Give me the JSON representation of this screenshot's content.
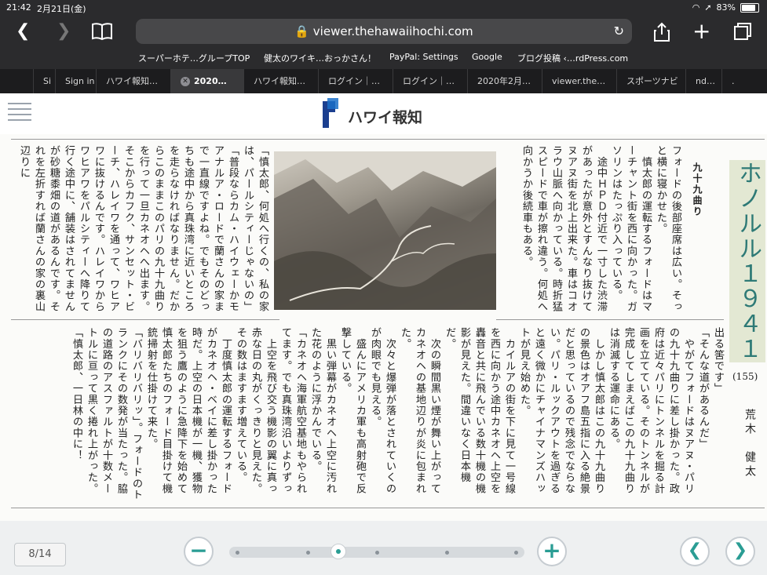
{
  "status": {
    "time": "21:42",
    "date": "2月21日(金)",
    "battery": "83%",
    "battery_level": 0.83
  },
  "toolbar": {
    "url": "viewer.thehawaiihochi.com"
  },
  "favorites": [
    "スーパーホテ…グループTOP",
    "健太のワイキ…おっかさん！",
    "PayPal: Settings",
    "Google",
    "ブログ投稿 ‹…rdPress.com"
  ],
  "tabs": [
    "Si",
    "Sign in",
    "ハワイ報知…",
    "2020…",
    "ハワイ報知…",
    "ログイン｜…",
    "ログイン｜…",
    "2020年2月…",
    "viewer.the…",
    "スポーツナビ",
    "nd…",
    "."
  ],
  "active_tab_index": 3,
  "site": {
    "name": "ハワイ報知"
  },
  "article": {
    "series_title": "ホノルル１９４１",
    "episode": "(155)",
    "author": "荒木　健太",
    "section_heading": "九十九曲り",
    "columns": [
      "フォードの後部座席は広い。そっと横に寝かせた。\n　慎太郎の運転するフォードはマーチャント街を西に向かった。ガソリンはたっぷり入っている。\n　途中ＨＰＤ付近で一寸した渋滞があったが意外とすんなり抜けてヌアヌ街を北上出来た。車はコオラウ山脈へ向かっている。時折猛スピードで車が擦れ違う。何処へ向かうか後続車もある。",
      "「慎太郎、何処へ行くの、私の家は、パールシティーじゃないの」\n「普段ならカム・ハイウェーかモアナルア・ロードで蘭さんの家まで一直線ですよね。でもそのどっちも途中から真珠湾に近いところを走らなければなりません。だからこのままこのパリの九十九曲りを行って一旦カネオヘへ出ます。そこからカフク、サンセット・ビーチ、ハレイワを通って、ワヒアワに抜けるんです。ハレイワからワヒアワをパルシティーへ降りて行く途中に、舗装はされてませんが砂糖黍畑の道があるんです。それを左折すれば蘭さんの家の裏山辺りに",
      "出る筈です」\n「そんな道があるんだ」\n　やがてフォードはヌアヌ・パリの九十九曲りに差し掛かった。政府は近々パリにトンネルを掘る計画を立てている。そのトンネルが完成してしまえばこの九十九曲りは消滅する運命にある。\n　しかし慎太郎はこの九十九曲りの景色はオアフ島五指に入る絶景だと思っているので残念でならない。パリ・ルックアウトを過ぎると遠く微かにチャイナマンズハットが見え始めた。\n　カイルアの街を下に見て一号線を西に向かう途中カネオヘ上空を轟音と共に飛んでいる数十機の機影が見えた。間違いなく日本機だ。\n　次の瞬間黒い煙が舞い上がってカネオヘの基地辺りが炎に包まれた。\n　次々と爆弾が落とされていくのが肉眼でも見える。\n　盛んにアメリカ軍も高射砲で反撃している。\n　黒い弾幕がカネオヘ上空に汚れた花のように浮かんでいる。\n「カネオヘ海軍航空基地もやられてます。でも真珠湾沿いよりずっと安全でしょう」",
      "　上空を飛び交う機影の翼に真っ赤な日の丸がくっきりと見えた。その数はますます増えている。\n　丁度慎太郎の運転するフォードがカネオヘ・ベイに差し掛かった時だ。上空の日本機が一機、獲物を狙う鷹のように急降下を始めて慎太郎たちのフォード目掛けて機銃掃射を仕掛けて来た。\n「バリバリバリッ」。フォードのトランクにその数発が当たった。脇の道路のアスファルトが十数メートルに亘って黒く捲れ上がった。\n「慎太郎、一日林の中に！"
    ]
  },
  "viewer": {
    "page_indicator": "8/14",
    "current_page": 8,
    "total_pages": 14
  },
  "colors": {
    "accent": "#2a9d94",
    "title_bg": "#e3e8d3",
    "title_text": "#2e7a76",
    "browser_bg": "#2b2b2d"
  }
}
